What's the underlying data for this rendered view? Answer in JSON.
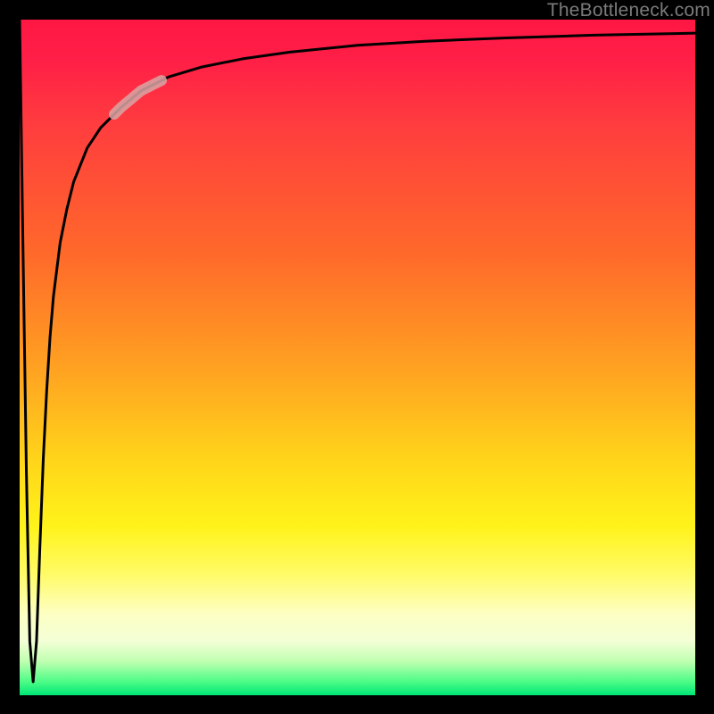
{
  "attribution": "TheBottleneck.com",
  "chart_data": {
    "type": "line",
    "title": "",
    "xlabel": "",
    "ylabel": "",
    "xlim": [
      0,
      100
    ],
    "ylim": [
      0,
      100
    ],
    "background_gradient": {
      "orientation": "vertical",
      "stops": [
        {
          "pos": 0,
          "color": "#ff1744"
        },
        {
          "pos": 35,
          "color": "#ff6a2a"
        },
        {
          "pos": 65,
          "color": "#ffd41a"
        },
        {
          "pos": 88,
          "color": "#fdffc4"
        },
        {
          "pos": 100,
          "color": "#00e676"
        }
      ]
    },
    "series": [
      {
        "name": "bottleneck-curve",
        "x": [
          0.0,
          0.5,
          1.0,
          1.5,
          2.0,
          2.5,
          3.0,
          3.5,
          4.0,
          4.5,
          5.0,
          6.0,
          7.0,
          8.0,
          10.0,
          12.0,
          15.0,
          18.0,
          22.0,
          27.0,
          33.0,
          40.0,
          50.0,
          60.0,
          72.0,
          85.0,
          100.0
        ],
        "y": [
          100.0,
          66.0,
          33.0,
          8.0,
          2.0,
          8.0,
          22.0,
          35.0,
          45.0,
          53.0,
          59.0,
          67.0,
          72.0,
          76.0,
          81.0,
          84.0,
          87.0,
          89.5,
          91.5,
          93.0,
          94.2,
          95.2,
          96.2,
          96.8,
          97.3,
          97.7,
          98.0
        ],
        "stroke": "#000000",
        "stroke_width": 3
      }
    ],
    "highlight": {
      "name": "segment-highlight",
      "x_range": [
        14.0,
        21.0
      ],
      "color": "#d8a6a4",
      "width": 12
    }
  }
}
